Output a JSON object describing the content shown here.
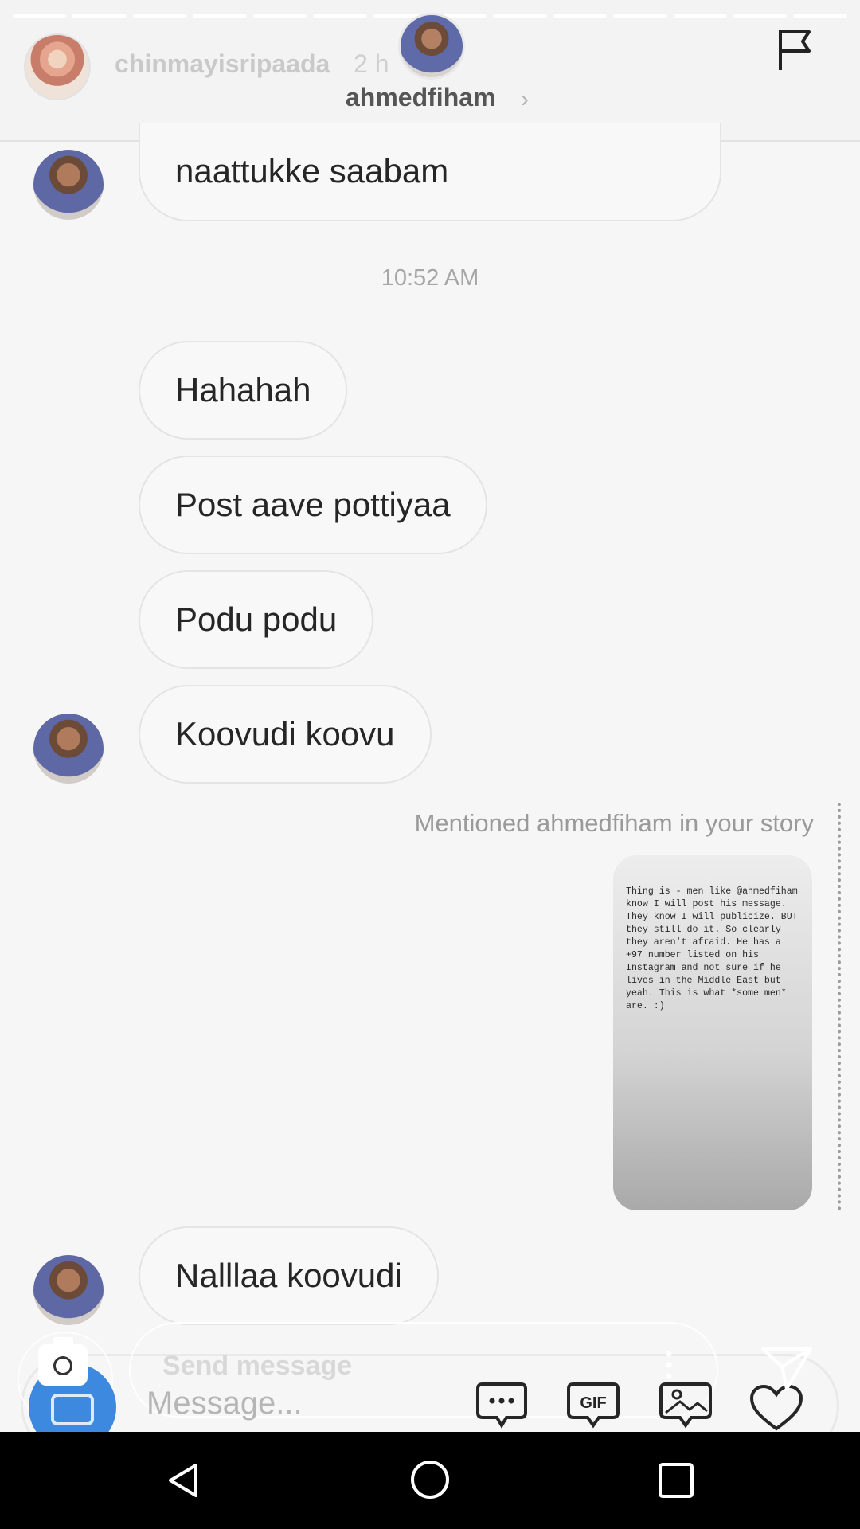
{
  "story": {
    "username": "chinmayisripaada",
    "time": "2 h",
    "progress_segments": 14
  },
  "thread": {
    "name": "ahmedfiham"
  },
  "messages": [
    {
      "text": "naattukke saabam"
    },
    {
      "text": "Hahahah"
    },
    {
      "text": "Post aave pottiyaa"
    },
    {
      "text": "Podu podu"
    },
    {
      "text": "Koovudi koovu"
    },
    {
      "text": "Nalllaa koovudi"
    }
  ],
  "timestamp": "10:52 AM",
  "mention_note": "Mentioned ahmedfiham in your story",
  "shared_story_text": "Thing is - men like @ahmedfiham know I will post his message. They know I will publicize. BUT they still do it. So clearly they aren't afraid. He has a +97 number listed on his Instagram and not sure if he lives in the Middle East but yeah. This is what *some men* are. :)",
  "compose": {
    "story_reply_placeholder": "Send message",
    "message_placeholder": "Message...",
    "gif_label": "GIF"
  },
  "icons": [
    "camera-icon",
    "flag-icon",
    "chevron-right-icon",
    "chat-bubble-icon",
    "gif-icon",
    "gallery-icon",
    "heart-icon",
    "send-icon",
    "more-icon",
    "back-icon",
    "home-icon",
    "recents-icon"
  ],
  "colors": {
    "accent": "#3c89df",
    "navbar": "#000000",
    "bubble_border": "#e4e4e4"
  }
}
